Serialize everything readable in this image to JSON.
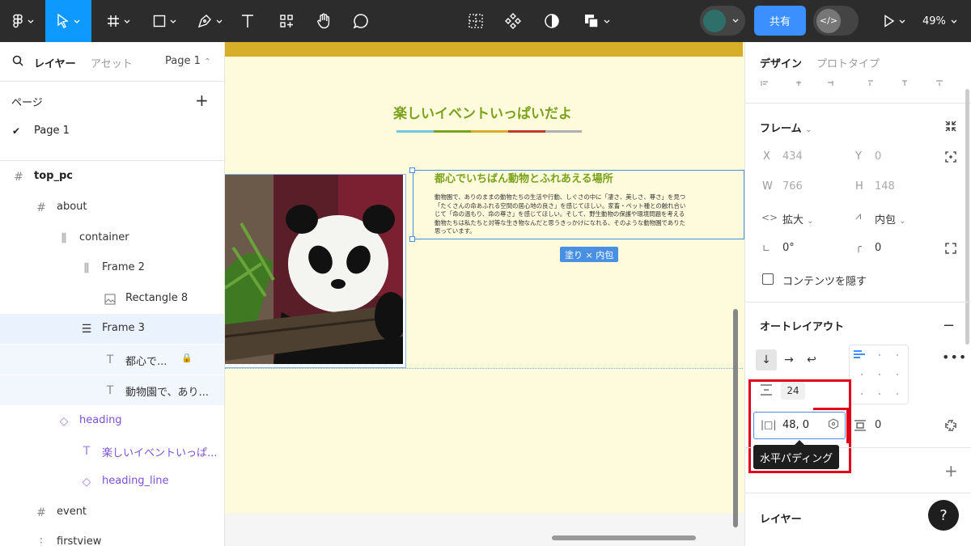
{
  "toolbar": {
    "share_label": "共有",
    "zoom_label": "49%",
    "dev_mode_label": "</>"
  },
  "left_panel": {
    "tab_layers": "レイヤー",
    "tab_assets": "アセット",
    "page_selector": "Page 1",
    "pages_label": "ページ",
    "pages": [
      "Page 1"
    ],
    "layers": [
      {
        "name": "top_pc"
      },
      {
        "name": "about"
      },
      {
        "name": "container"
      },
      {
        "name": "Frame 2"
      },
      {
        "name": "Rectangle 8"
      },
      {
        "name": "Frame 3"
      },
      {
        "name": "都心で..."
      },
      {
        "name": "動物園で、あり..."
      },
      {
        "name": "heading"
      },
      {
        "name": "楽しいイベントいっぱ..."
      },
      {
        "name": "heading_line"
      },
      {
        "name": "event"
      },
      {
        "name": "firstview"
      }
    ]
  },
  "canvas": {
    "heading": "楽しいイベントいっぱいだよ",
    "heading_line_colors": [
      "#74c6e0",
      "#7aa21c",
      "#d7ae2a",
      "#c0392b",
      "#b0b0b0"
    ],
    "section_title": "都心でいちばん動物とふれあえる場所",
    "section_body": [
      "動物園で、ありのままの動物たちの生活や行動、しぐさの中に「凄さ、美しさ、尊さ」を見つ",
      "「たくさんの命あふれる空間の居心地の良さ」を感じてほしい。家畜・ペット種との触れ合い",
      "じて「命の温もり、命の尊さ」を感じてほしい。そして、野生動物の保護や環境問題を考える",
      "動物たちは私たちと対等な生き物なんだと思うきっかけになれる、そのような動物園でありた",
      "思っています。"
    ],
    "badge": "塗り × 内包"
  },
  "right_panel": {
    "tab_design": "デザイン",
    "tab_prototype": "プロトタイプ",
    "frame_title": "フレーム",
    "x_label": "X",
    "x_value": "434",
    "y_label": "Y",
    "y_value": "0",
    "w_label": "W",
    "w_value": "766",
    "h_label": "H",
    "h_value": "148",
    "w_sizing": "拡大",
    "h_sizing": "内包",
    "rotation": "0°",
    "radius": "0",
    "clip_label": "コンテンツを隠す",
    "autolayout_title": "オートレイアウト",
    "gap": "24",
    "h_padding": "48, 0",
    "v_padding": "0",
    "tooltip": "水平パディング",
    "layer_title": "レイヤー",
    "help": "?"
  }
}
